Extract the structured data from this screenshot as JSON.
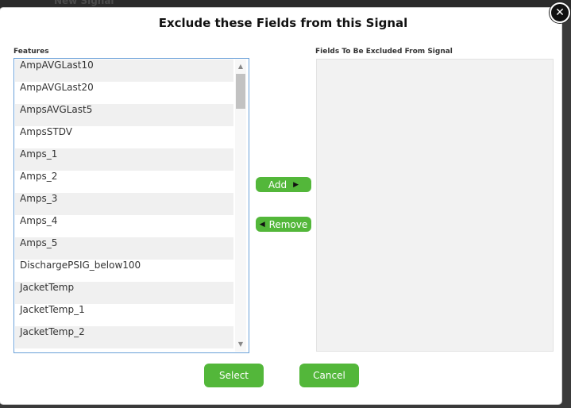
{
  "background": {
    "title": "New Signal"
  },
  "dialog": {
    "title": "Exclude these Fields from this Signal",
    "close_glyph": "✕"
  },
  "features": {
    "label": "Features",
    "items": [
      "AmpAVGLast10",
      "AmpAVGLast20",
      "AmpsAVGLast5",
      "AmpsSTDV",
      "Amps_1",
      "Amps_2",
      "Amps_3",
      "Amps_4",
      "Amps_5",
      "DischargePSIG_below100",
      "JacketTemp",
      "JacketTemp_1",
      "JacketTemp_2"
    ]
  },
  "excluded": {
    "label": "Fields To Be Excluded From Signal",
    "items": []
  },
  "transfer": {
    "add_label": "Add",
    "add_icon": "▶",
    "remove_label": "Remove",
    "remove_icon": "◀"
  },
  "actions": {
    "select_label": "Select",
    "cancel_label": "Cancel"
  },
  "scroll": {
    "up_icon": "▲",
    "down_icon": "▼"
  },
  "colors": {
    "accent": "#53b73a",
    "list_border": "#6aa0d8",
    "excluded_bg": "#f2f2f2"
  }
}
